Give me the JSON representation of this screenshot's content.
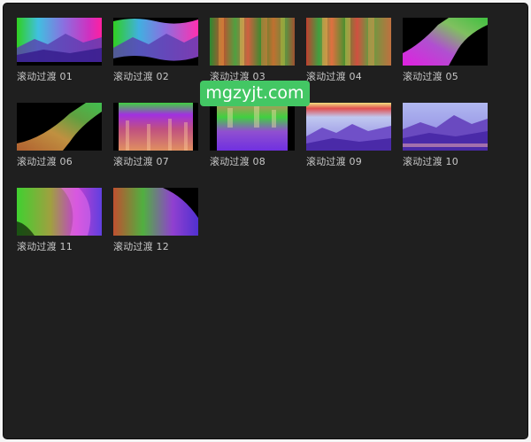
{
  "browser": {
    "items": [
      {
        "label": "滚动过渡 01",
        "thumbnail": "mountain-gradient"
      },
      {
        "label": "滚动过渡 02",
        "thumbnail": "mountain-gradient-wave"
      },
      {
        "label": "滚动过渡 03",
        "thumbnail": "vertical-streaks"
      },
      {
        "label": "滚动过渡 04",
        "thumbnail": "vertical-streaks-warm"
      },
      {
        "label": "滚动过渡 05",
        "thumbnail": "diagonal-ribbon"
      },
      {
        "label": "滚动过渡 06",
        "thumbnail": "diagonal-sweep"
      },
      {
        "label": "滚动过渡 07",
        "thumbnail": "drip-curtain"
      },
      {
        "label": "滚动过渡 08",
        "thumbnail": "cylinder-blur"
      },
      {
        "label": "滚动过渡 09",
        "thumbnail": "mountain-horizon"
      },
      {
        "label": "滚动过渡 10",
        "thumbnail": "mountain-horizon-purple"
      },
      {
        "label": "滚动过渡 11",
        "thumbnail": "curl-swirl"
      },
      {
        "label": "滚动过渡 12",
        "thumbnail": "wave-ribbon"
      }
    ]
  },
  "watermark": {
    "text": "mgzyjt.com",
    "color": "#43c764"
  },
  "colors": {
    "panel_bg": "#1f1f1f",
    "label_text": "#c8c8c8"
  }
}
